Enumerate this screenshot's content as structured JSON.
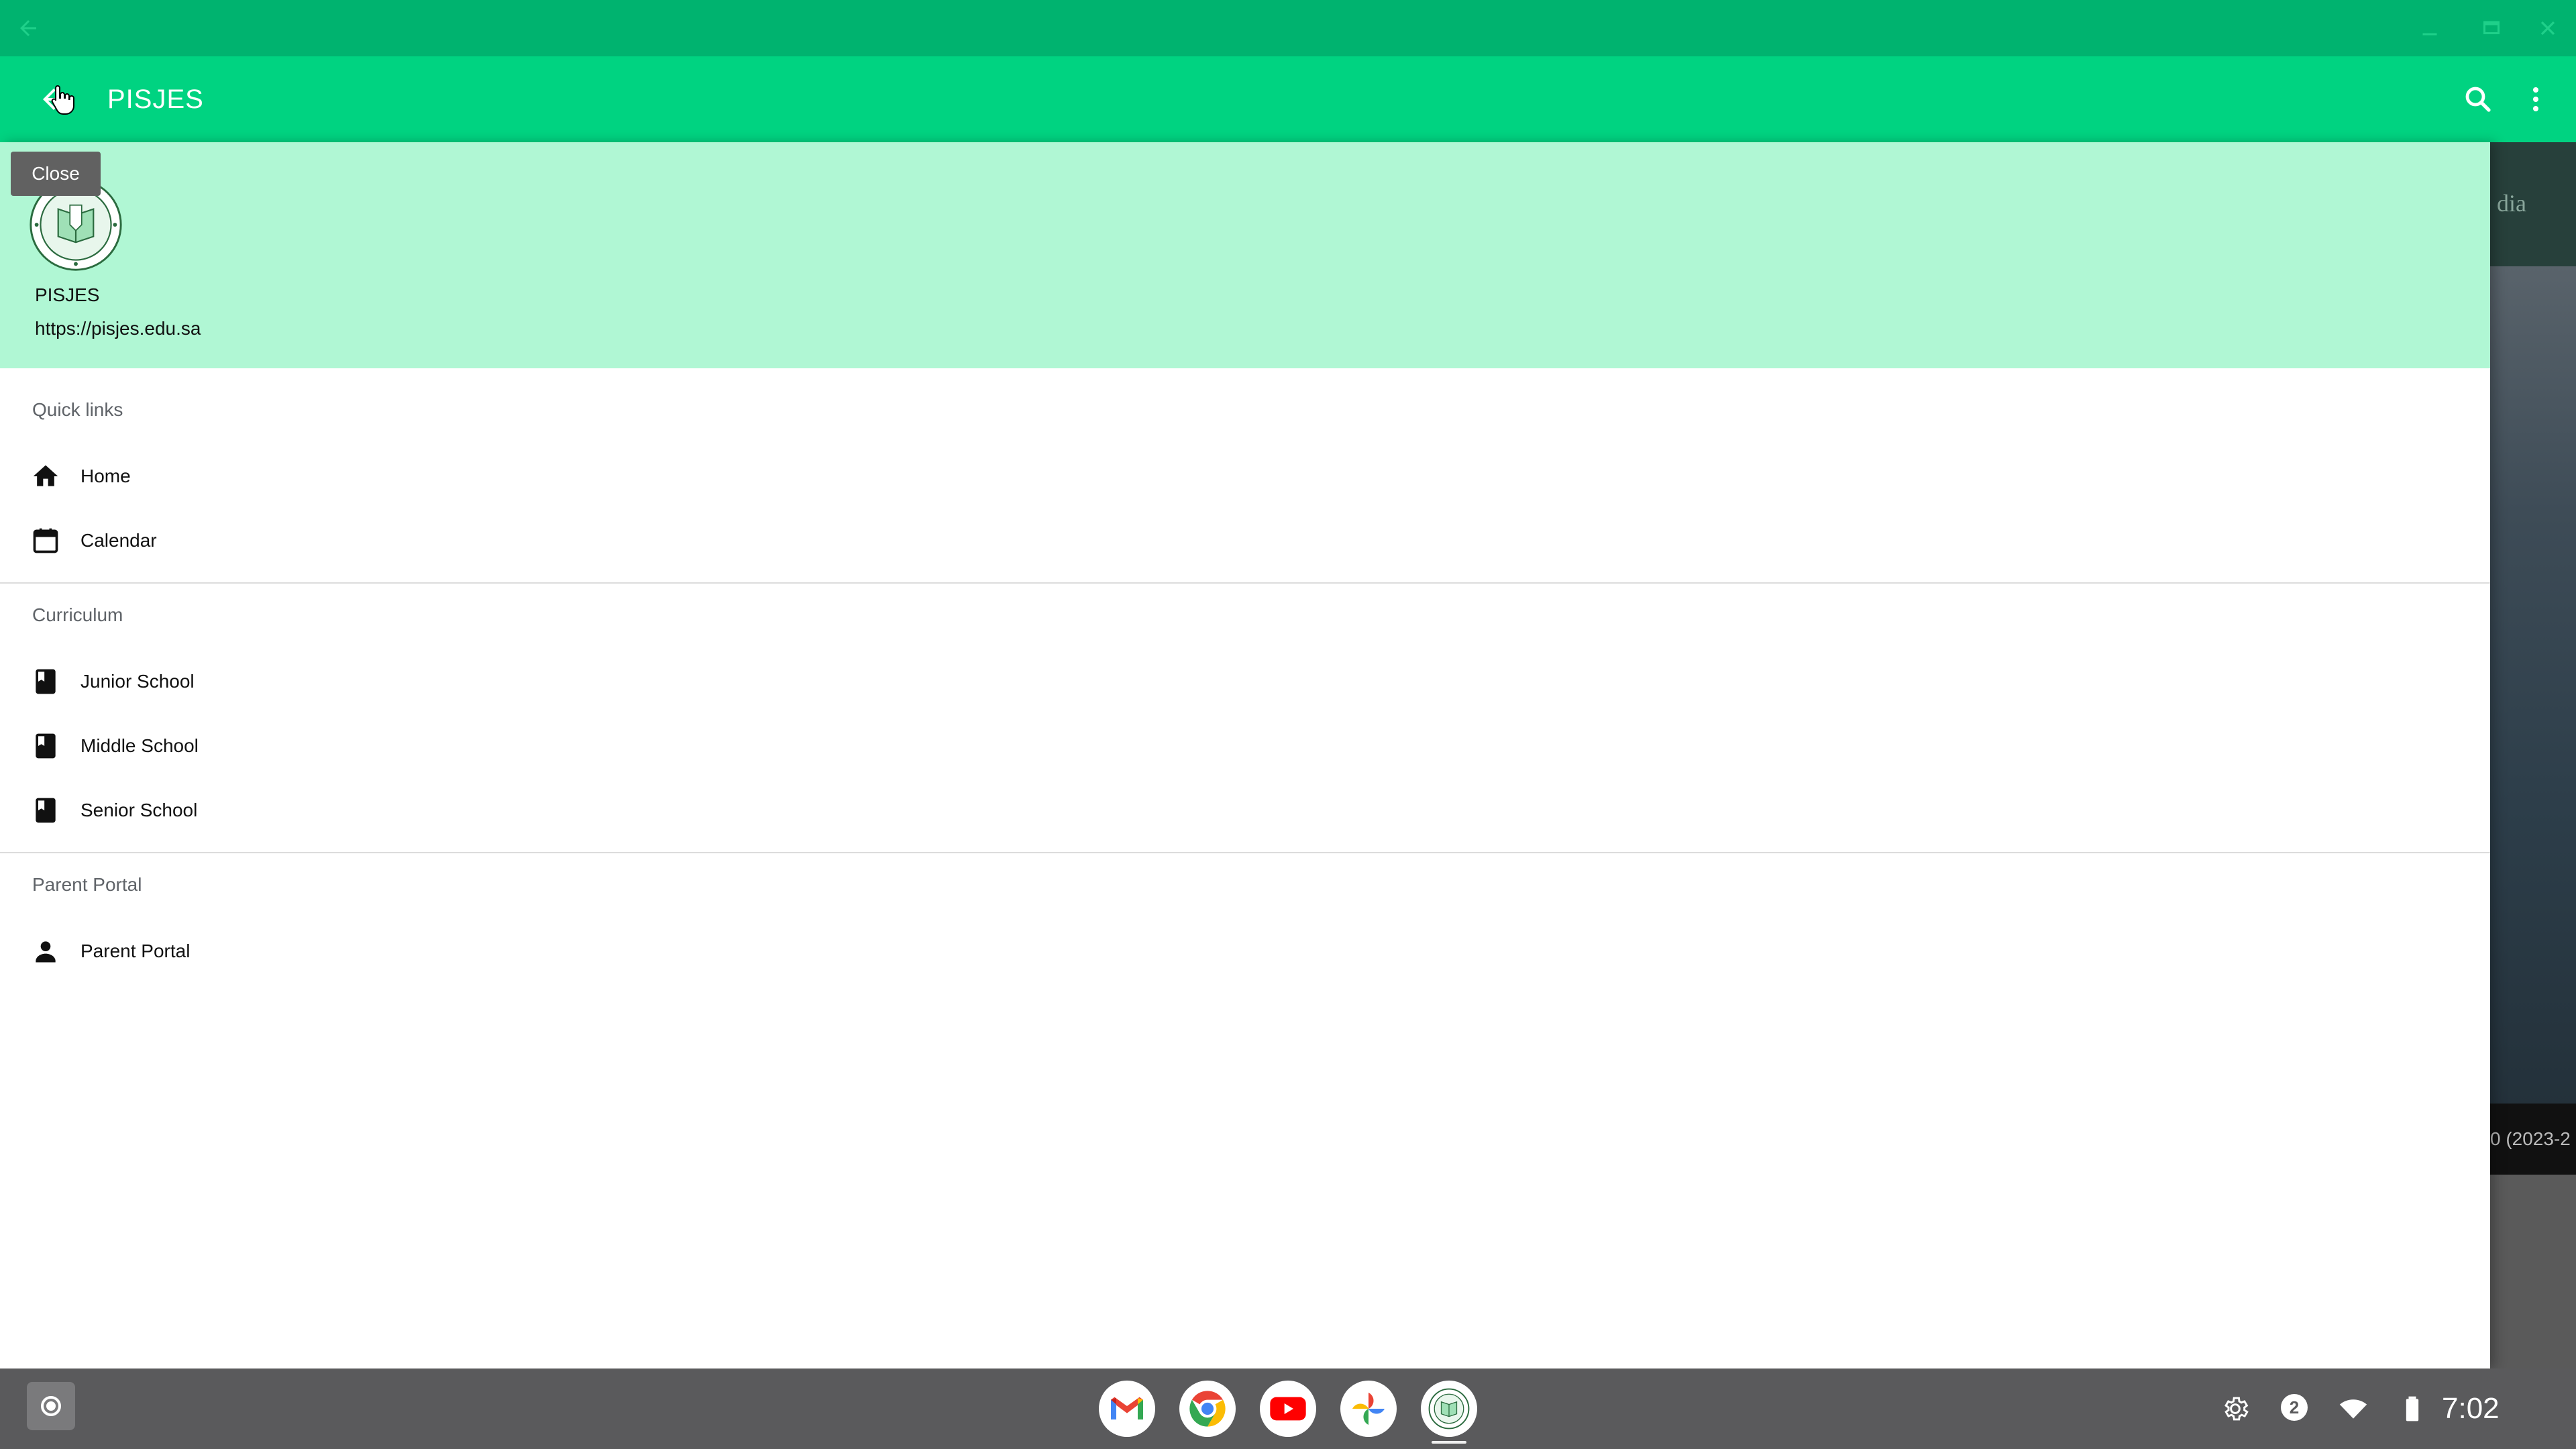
{
  "app_bar": {
    "title": "PISJES"
  },
  "tooltip": {
    "text": "Close"
  },
  "drawer": {
    "header": {
      "title": "PISJES",
      "url": "https://pisjes.edu.sa"
    },
    "sections": [
      {
        "label": "Quick links",
        "items": [
          {
            "label": "Home",
            "icon": "home-icon"
          },
          {
            "label": "Calendar",
            "icon": "calendar-icon"
          }
        ]
      },
      {
        "label": "Curriculum",
        "items": [
          {
            "label": "Junior School",
            "icon": "book-icon"
          },
          {
            "label": "Middle School",
            "icon": "book-icon"
          },
          {
            "label": "Senior School",
            "icon": "book-icon"
          }
        ]
      },
      {
        "label": "Parent Portal",
        "items": [
          {
            "label": "Parent Portal",
            "icon": "person-icon"
          }
        ]
      }
    ]
  },
  "background_page": {
    "menu_fragment": "dia",
    "caption_fragment": "0 (2023-2"
  },
  "shelf": {
    "apps": [
      "Gmail",
      "Chrome",
      "YouTube",
      "Google Photos",
      "PISJES"
    ],
    "notification_count": "2",
    "clock": "7:02"
  },
  "colors": {
    "frame": "#00b36f",
    "app_bar": "#00d381",
    "drawer_header": "#b0f7d4",
    "shelf": "#5a5a5c"
  }
}
